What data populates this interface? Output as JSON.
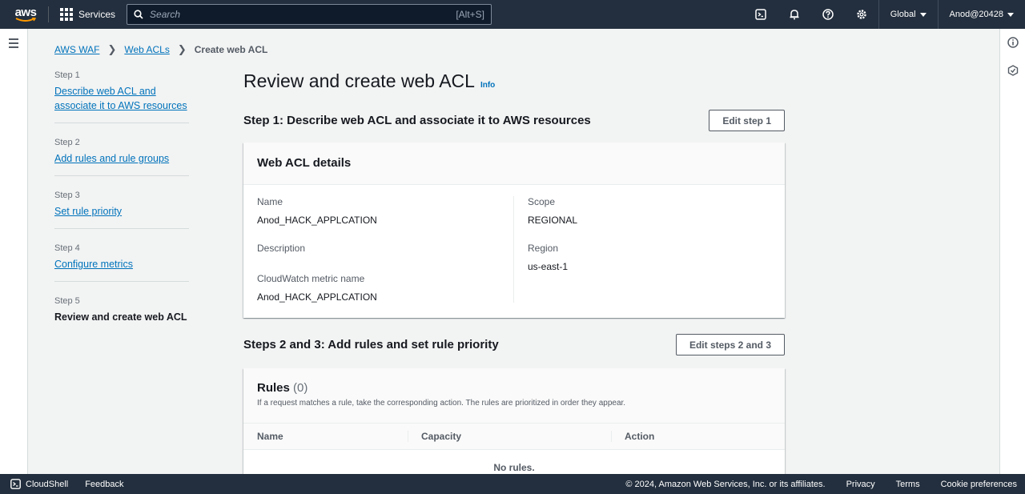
{
  "topnav": {
    "logo_text": "aws",
    "services_label": "Services",
    "search_placeholder": "Search",
    "search_shortcut": "[Alt+S]",
    "region_label": "Global",
    "account_label": "Anod@20428",
    "icons": [
      "cloudshell-icon",
      "bell-icon",
      "help-icon",
      "settings-icon"
    ]
  },
  "breadcrumb": {
    "items": [
      "AWS WAF",
      "Web ACLs"
    ],
    "current": "Create web ACL"
  },
  "steps": [
    {
      "num": "Step 1",
      "label": "Describe web ACL and associate it to AWS resources"
    },
    {
      "num": "Step 2",
      "label": "Add rules and rule groups"
    },
    {
      "num": "Step 3",
      "label": "Set rule priority"
    },
    {
      "num": "Step 4",
      "label": "Configure metrics"
    },
    {
      "num": "Step 5",
      "label": "Review and create web ACL"
    }
  ],
  "page": {
    "title": "Review and create web ACL",
    "info_label": "Info"
  },
  "section1": {
    "title": "Step 1: Describe web ACL and associate it to AWS resources",
    "edit_button": "Edit step 1",
    "card_title": "Web ACL details",
    "name_label": "Name",
    "name_value": "Anod_HACK_APPLCATION",
    "description_label": "Description",
    "metric_label": "CloudWatch metric name",
    "metric_value": "Anod_HACK_APPLCATION",
    "scope_label": "Scope",
    "scope_value": "REGIONAL",
    "region_label": "Region",
    "region_value": "us-east-1"
  },
  "section2": {
    "title": "Steps 2 and 3: Add rules and set rule priority",
    "edit_button": "Edit steps 2 and 3",
    "rules_title": "Rules",
    "rules_count": "(0)",
    "rules_desc": "If a request matches a rule, take the corresponding action. The rules are prioritized in order they appear.",
    "columns": [
      "Name",
      "Capacity",
      "Action"
    ],
    "empty_text": "No rules."
  },
  "footer": {
    "cloudshell": "CloudShell",
    "feedback": "Feedback",
    "copyright": "© 2024, Amazon Web Services, Inc. or its affiliates.",
    "privacy": "Privacy",
    "terms": "Terms",
    "cookie": "Cookie preferences"
  },
  "colors": {
    "nav_bg": "#232f3e",
    "link": "#0073bb",
    "page_bg": "#f2f3f3"
  }
}
